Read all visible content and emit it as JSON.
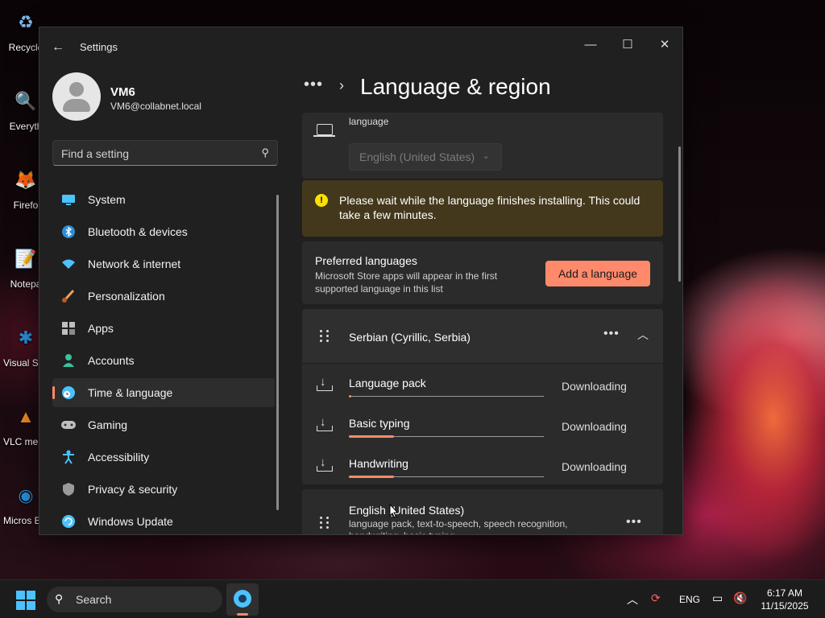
{
  "desktop": {
    "icons": [
      {
        "label": "Recycle",
        "glyph": "♻",
        "color": "#7fb8e6"
      },
      {
        "label": "Everyth",
        "glyph": "🔍",
        "color": "#f08a24"
      },
      {
        "label": "Firefo",
        "glyph": "🦊",
        "color": "#ff6b1a"
      },
      {
        "label": "Notepa",
        "glyph": "📝",
        "color": "#7cbf4a"
      },
      {
        "label": "Visual St Cod",
        "glyph": "✱",
        "color": "#2a8fd8"
      },
      {
        "label": "VLC me playe",
        "glyph": "▲",
        "color": "#f08a24"
      },
      {
        "label": "Micros Edge",
        "glyph": "◉",
        "color": "#2a8fd8"
      }
    ]
  },
  "window": {
    "app_title": "Settings",
    "controls": {
      "minimize": "—",
      "maximize": "☐",
      "close": "✕"
    }
  },
  "user": {
    "name": "VM6",
    "email": "VM6@collabnet.local"
  },
  "search": {
    "placeholder": "Find a setting"
  },
  "nav": {
    "items": [
      {
        "label": "System",
        "icon": "monitor-icon",
        "color": "#4cc2ff",
        "selected": false
      },
      {
        "label": "Bluetooth & devices",
        "icon": "bluetooth-icon",
        "color": "#2a8fd8",
        "selected": false
      },
      {
        "label": "Network & internet",
        "icon": "wifi-icon",
        "color": "#4cc2ff",
        "selected": false
      },
      {
        "label": "Personalization",
        "icon": "brush-icon",
        "color": "#e8a060",
        "selected": false
      },
      {
        "label": "Apps",
        "icon": "apps-icon",
        "color": "#bfbfbf",
        "selected": false
      },
      {
        "label": "Accounts",
        "icon": "person-icon",
        "color": "#3ac2a0",
        "selected": false
      },
      {
        "label": "Time & language",
        "icon": "globe-clock-icon",
        "color": "#4cc2ff",
        "selected": true
      },
      {
        "label": "Gaming",
        "icon": "controller-icon",
        "color": "#bfbfbf",
        "selected": false
      },
      {
        "label": "Accessibility",
        "icon": "accessibility-icon",
        "color": "#4cc2ff",
        "selected": false
      },
      {
        "label": "Privacy & security",
        "icon": "shield-icon",
        "color": "#9a9a9a",
        "selected": false
      },
      {
        "label": "Windows Update",
        "icon": "update-icon",
        "color": "#4cc2ff",
        "selected": false
      }
    ]
  },
  "header": {
    "breadcrumb_more": "•••",
    "title": "Language & region"
  },
  "windows_display_language": {
    "desc_partial": "language",
    "dropdown_value": "English (United States)"
  },
  "info_bar": {
    "message": "Please wait while the language finishes installing. This could take a few minutes."
  },
  "preferred_languages": {
    "heading": "Preferred languages",
    "subtext": "Microsoft Store apps will appear in the first supported language in this list",
    "add_button": "Add a language"
  },
  "languages": [
    {
      "name": "Serbian (Cyrillic, Serbia)",
      "features": [
        {
          "name": "Language pack",
          "status": "Downloading",
          "progress": 0.01
        },
        {
          "name": "Basic typing",
          "status": "Downloading",
          "progress": 0.23
        },
        {
          "name": "Handwriting",
          "status": "Downloading",
          "progress": 0.23
        }
      ]
    },
    {
      "name": "English (United States)",
      "subtext": "language pack, text-to-speech, speech recognition, handwriting, basic typing"
    }
  ],
  "taskbar": {
    "search_label": "Search",
    "language": "ENG",
    "time": "6:17 AM",
    "date": "11/15/2025",
    "accent": "#4cc2ff"
  }
}
